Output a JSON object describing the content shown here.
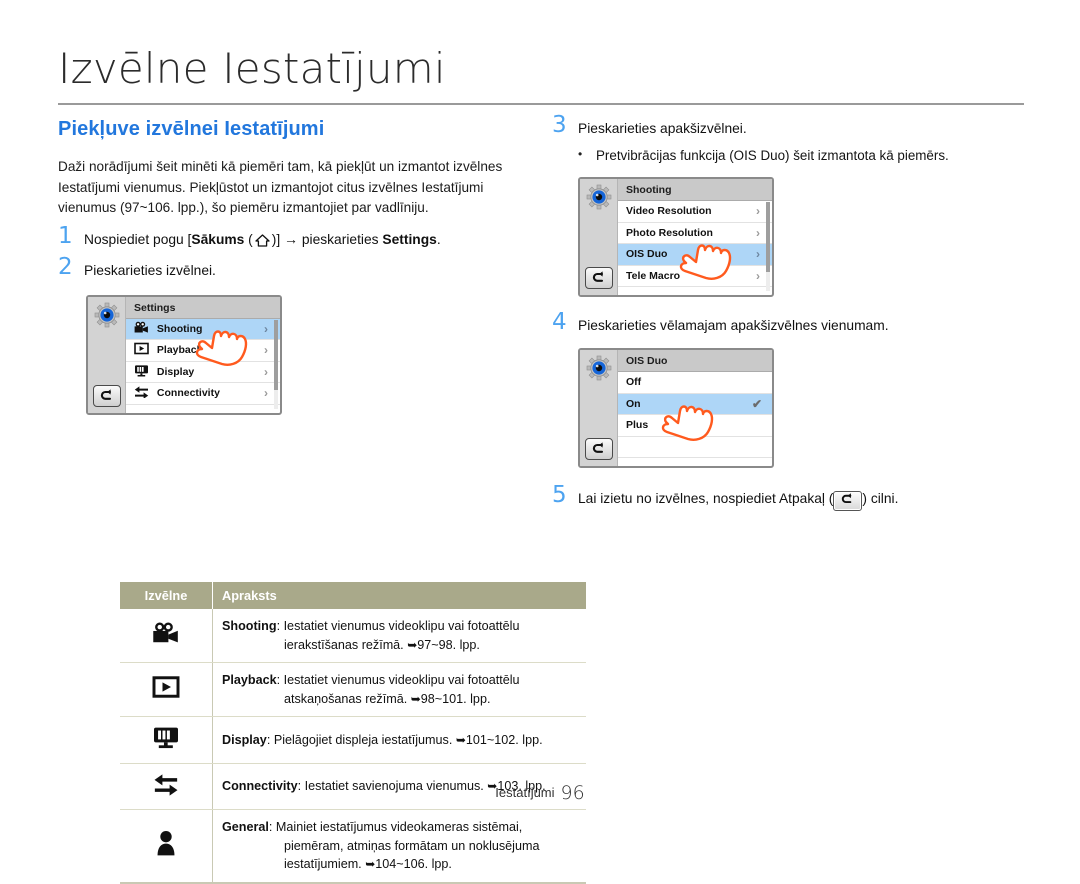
{
  "header": {
    "title": "Izvēlne Iestatījumi"
  },
  "left": {
    "section_heading": "Piekļuve izvēlnei Iestatījumi",
    "paragraph": "Daži norādījumi šeit minēti kā piemēri tam, kā piekļūt un izmantot izvēlnes Iestatījumi vienumus. Piekļūstot un izmantojot citus izvēlnes Iestatījumi vienumus (97~106. lpp.), šo piemēru izmantojiet par vadlīniju.",
    "step1": {
      "num": "1",
      "pre": "Nospiediet pogu [",
      "bold1": "Sākums",
      "paren_open": " (",
      "icon": "home-icon",
      "paren_close": ")] ",
      "arrow": "→",
      "mid": " pieskarieties ",
      "bold2": "Settings",
      "post": "."
    },
    "step2": {
      "num": "2",
      "text": "Pieskarieties izvēlnei."
    },
    "device_settings": {
      "title": "Settings",
      "rows": [
        {
          "label": "Shooting",
          "icon": "camcorder-icon",
          "selected": true,
          "chevron": "›"
        },
        {
          "label": "Playback",
          "icon": "play-box-icon",
          "selected": false,
          "chevron": "›"
        },
        {
          "label": "Display",
          "icon": "display-icon",
          "selected": false,
          "chevron": "›"
        },
        {
          "label": "Connectivity",
          "icon": "connectivity-icon",
          "selected": false,
          "chevron": "›"
        }
      ],
      "back_icon": "back-arrow-icon",
      "gear_icon": "gear-icon"
    }
  },
  "table": {
    "headers": [
      "Izvēlne",
      "Apraksts"
    ],
    "rows": [
      {
        "icon": "camcorder-icon",
        "label": "Shooting",
        "sep": ": ",
        "line1": "Iestatiet vienumus videoklipu vai fotoattēlu",
        "line2": "ierakstīšanas režīmā.",
        "page_arrow": "➥",
        "pages": "97~98. lpp."
      },
      {
        "icon": "play-box-icon",
        "label": "Playback",
        "sep": ": ",
        "line1": "Iestatiet vienumus videoklipu vai fotoattēlu",
        "line2": "atskaņošanas režīmā.",
        "page_arrow": "➥",
        "pages": "98~101. lpp."
      },
      {
        "icon": "display-icon",
        "label": "Display",
        "sep": ": ",
        "line1": "Pielāgojiet displeja iestatījumus.",
        "line2": "",
        "page_arrow": "➥",
        "pages": "101~102. lpp."
      },
      {
        "icon": "connectivity-icon",
        "label": "Connectivity",
        "sep": ": ",
        "line1": "Iestatiet savienojuma vienumus.",
        "line2": "",
        "page_arrow": "➥",
        "pages": "103. lpp."
      },
      {
        "icon": "person-icon",
        "label": "General",
        "sep": ": ",
        "line1": "Mainiet iestatījumus videokameras sistēmai,",
        "line2": "piemēram, atmiņas formātam un noklusējuma",
        "line3": "iestatījumiem.",
        "page_arrow": "➥",
        "pages": "104~106. lpp."
      }
    ]
  },
  "right": {
    "step3": {
      "num": "3",
      "text": "Pieskarieties apakšizvēlnei.",
      "bullet": "Pretvibrācijas funkcija (OIS Duo) šeit izmantota kā piemērs."
    },
    "device_shooting": {
      "title": "Shooting",
      "rows": [
        {
          "label": "Video Resolution",
          "selected": false,
          "chevron": "›"
        },
        {
          "label": "Photo Resolution",
          "selected": false,
          "chevron": "›"
        },
        {
          "label": "OIS Duo",
          "selected": true,
          "chevron": "›"
        },
        {
          "label": "Tele Macro",
          "selected": false,
          "chevron": "›"
        }
      ],
      "back_icon": "back-arrow-icon",
      "gear_icon": "gear-icon"
    },
    "step4": {
      "num": "4",
      "text": "Pieskarieties vēlamajam apakšizvēlnes vienumam."
    },
    "device_ois": {
      "title": "OIS Duo",
      "rows": [
        {
          "label": "Off",
          "selected": false,
          "check": ""
        },
        {
          "label": "On",
          "selected": true,
          "check": "✔"
        },
        {
          "label": "Plus",
          "selected": false,
          "check": ""
        }
      ],
      "back_icon": "back-arrow-icon",
      "gear_icon": "gear-icon"
    },
    "step5": {
      "num": "5",
      "pre": "Lai izietu no izvēlnes, nospiediet Atpakaļ (",
      "icon": "back-arrow-icon",
      "post": ") cilni."
    }
  },
  "footer": {
    "label": "Iestatījumi",
    "page": "96"
  },
  "colors": {
    "accent_blue": "#2277dd",
    "step_number": "#4da3f0",
    "table_header": "#a9a98a",
    "selection": "#aed6f7",
    "hand_outline": "#ff5a1e",
    "device_side": "#d3d3d3",
    "device_title": "#c9c9c9"
  }
}
